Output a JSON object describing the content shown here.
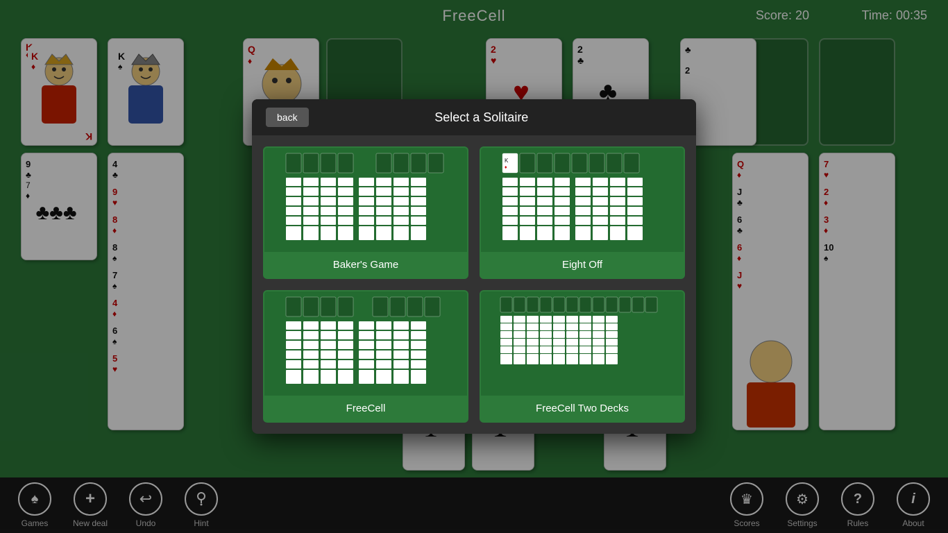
{
  "header": {
    "title": "FreeCell",
    "score_label": "Score:",
    "score_value": "20",
    "time_label": "Time:",
    "time_value": "00:35"
  },
  "toolbar": {
    "left_buttons": [
      {
        "id": "games",
        "label": "Games",
        "icon": "♠"
      },
      {
        "id": "new-deal",
        "label": "New deal",
        "icon": "+"
      },
      {
        "id": "undo",
        "label": "Undo",
        "icon": "↩"
      },
      {
        "id": "hint",
        "label": "Hint",
        "icon": "💡"
      }
    ],
    "right_buttons": [
      {
        "id": "scores",
        "label": "Scores",
        "icon": "♛"
      },
      {
        "id": "settings",
        "label": "Settings",
        "icon": "⚙"
      },
      {
        "id": "rules",
        "label": "Rules",
        "icon": "?"
      },
      {
        "id": "about",
        "label": "About",
        "icon": "i"
      }
    ]
  },
  "modal": {
    "title": "Select a Solitaire",
    "back_label": "back",
    "options": [
      {
        "id": "bakers-game",
        "label": "Baker's Game"
      },
      {
        "id": "eight-off",
        "label": "Eight Off"
      },
      {
        "id": "freecell",
        "label": "FreeCell"
      },
      {
        "id": "freecell-two-decks",
        "label": "FreeCell Two Decks"
      }
    ]
  },
  "colors": {
    "green_bg": "#2d7a3a",
    "dark_green": "#236b30",
    "toolbar_bg": "#1a1a1a",
    "modal_bg": "#222",
    "red": "#cc0000",
    "black": "#111111"
  }
}
